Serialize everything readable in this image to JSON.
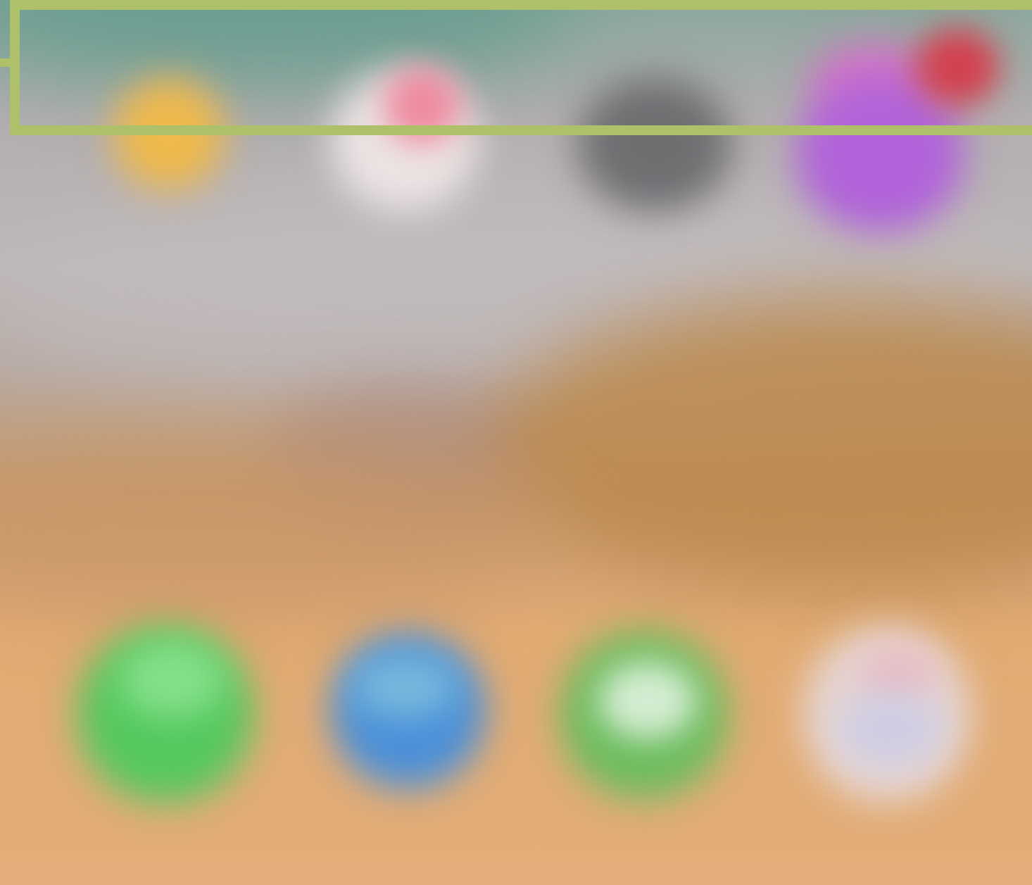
{
  "screen": {
    "type": "blurred-home-screen",
    "top_row_icons": [
      {
        "icon": "yellow-app-icon",
        "color": "#efb94b"
      },
      {
        "icon": "white-pink-app-icon",
        "color": "#ece4e4"
      },
      {
        "icon": "dark-grey-app-icon",
        "color": "#6f6f72"
      },
      {
        "icon": "purple-app-icon",
        "color": "#b163d9"
      }
    ],
    "dock_icons": [
      {
        "icon": "phone-icon",
        "color": "#55c85f"
      },
      {
        "icon": "safari-icon",
        "color": "#4a90d9"
      },
      {
        "icon": "messages-icon",
        "color": "#6cbd5f"
      },
      {
        "icon": "photos-icon",
        "color": "#e6d6d4"
      }
    ],
    "notification_badge": {
      "icon": "red-badge-icon",
      "color": "#d3404f"
    },
    "highlight": {
      "color": "#afc06a"
    }
  }
}
